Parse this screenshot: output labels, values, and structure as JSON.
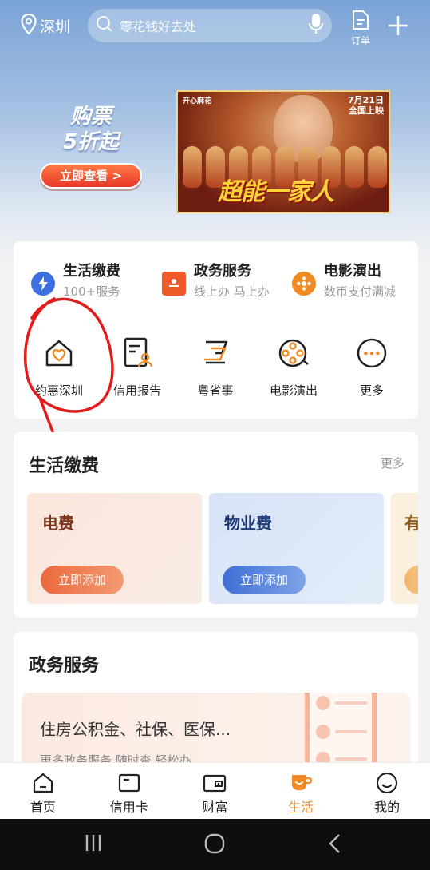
{
  "header": {
    "location": "深圳",
    "search_placeholder": "零花钱好去处",
    "order_label": "订单"
  },
  "promo": {
    "headline_line1": "购票",
    "headline_line2": "5折起",
    "button_label": "立即查看 >",
    "poster": {
      "brand": "开心麻花",
      "date_line1": "7月21日",
      "date_line2": "全国上映",
      "movie_title": "超能一家人"
    }
  },
  "services": {
    "top": [
      {
        "title": "生活缴费",
        "subtitle": "100+服务",
        "icon": "lightning-icon",
        "color": "#3d6fe0"
      },
      {
        "title": "政务服务",
        "subtitle": "线上办 马上办",
        "icon": "gov-doc-icon",
        "color": "#f0592a"
      },
      {
        "title": "电影演出",
        "subtitle": "数币支付满减",
        "icon": "film-reel-icon",
        "color": "#f08a24"
      }
    ],
    "grid": [
      {
        "label": "约惠深圳",
        "icon": "house-heart-icon"
      },
      {
        "label": "信用报告",
        "icon": "credit-report-icon"
      },
      {
        "label": "粤省事",
        "icon": "yue-service-icon"
      },
      {
        "label": "电影演出",
        "icon": "film-reel-icon"
      },
      {
        "label": "更多",
        "icon": "more-dots-icon"
      }
    ]
  },
  "bills": {
    "title": "生活缴费",
    "more": "更多",
    "items": [
      {
        "title": "电费",
        "button": "立即添加"
      },
      {
        "title": "物业费",
        "button": "立即添加"
      },
      {
        "title": "有",
        "button": ""
      }
    ]
  },
  "gov": {
    "title": "政务服务",
    "banner_title": "住房公积金、社保、医保...",
    "banner_subtitle": "更多政务服务 随时查 轻松办"
  },
  "nav": {
    "items": [
      {
        "label": "首页",
        "icon": "home-icon"
      },
      {
        "label": "信用卡",
        "icon": "credit-card-icon"
      },
      {
        "label": "财富",
        "icon": "wallet-icon"
      },
      {
        "label": "生活",
        "icon": "life-cup-icon",
        "active": true
      },
      {
        "label": "我的",
        "icon": "smile-face-icon"
      }
    ],
    "active_color": "#f08a24"
  }
}
